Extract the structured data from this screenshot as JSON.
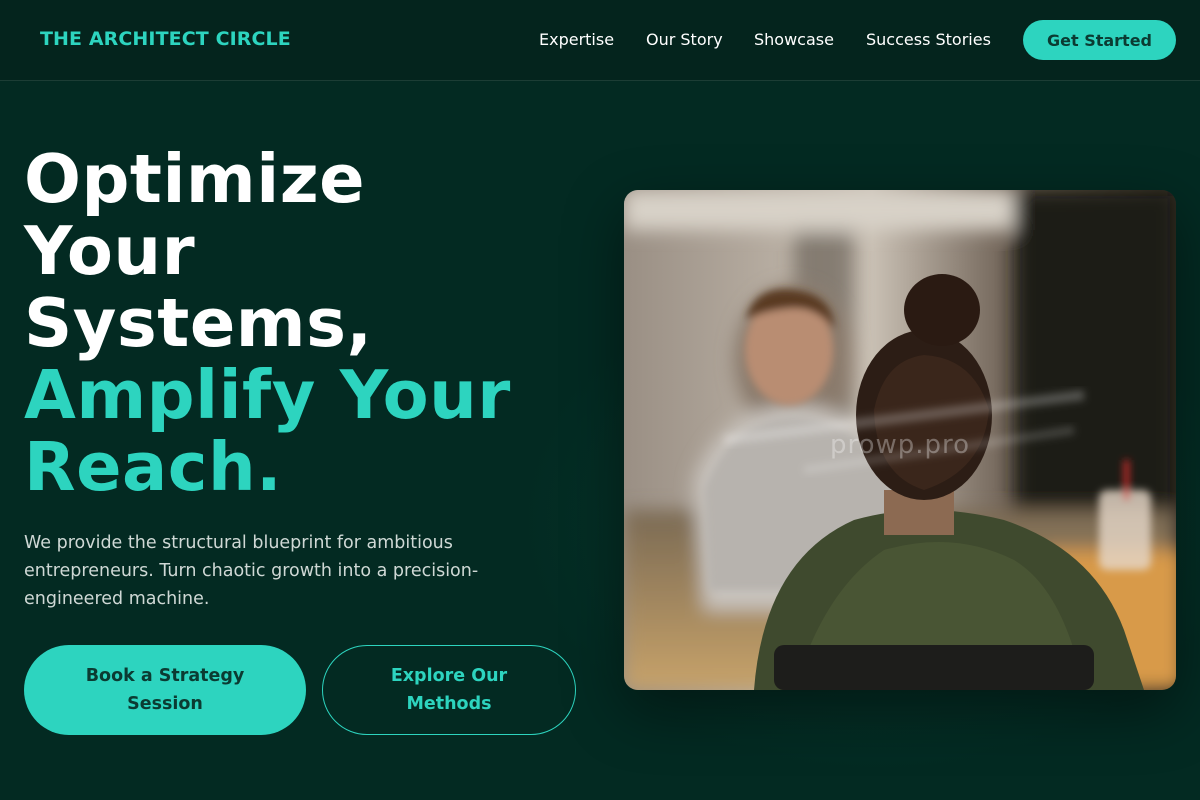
{
  "nav": {
    "brand": "THE ARCHITECT CIRCLE",
    "links": [
      "Expertise",
      "Our Story",
      "Showcase",
      "Success Stories"
    ],
    "cta_label": "Get Started"
  },
  "hero": {
    "headline_white": [
      "Optimize",
      "Your",
      "Systems,"
    ],
    "headline_accent": [
      "Amplify Your",
      "Reach."
    ],
    "subtext": "We provide the structural blueprint for ambitious entrepreneurs. Turn chaotic growth into a precision-engineered machine.",
    "primary_button": "Book a Strategy Session",
    "secondary_button": "Explore Our Methods",
    "image_watermark": "prowp.pro"
  },
  "colors": {
    "accent": "#2dd4bf",
    "background": "#032a22",
    "nav_background": "#04241d"
  }
}
